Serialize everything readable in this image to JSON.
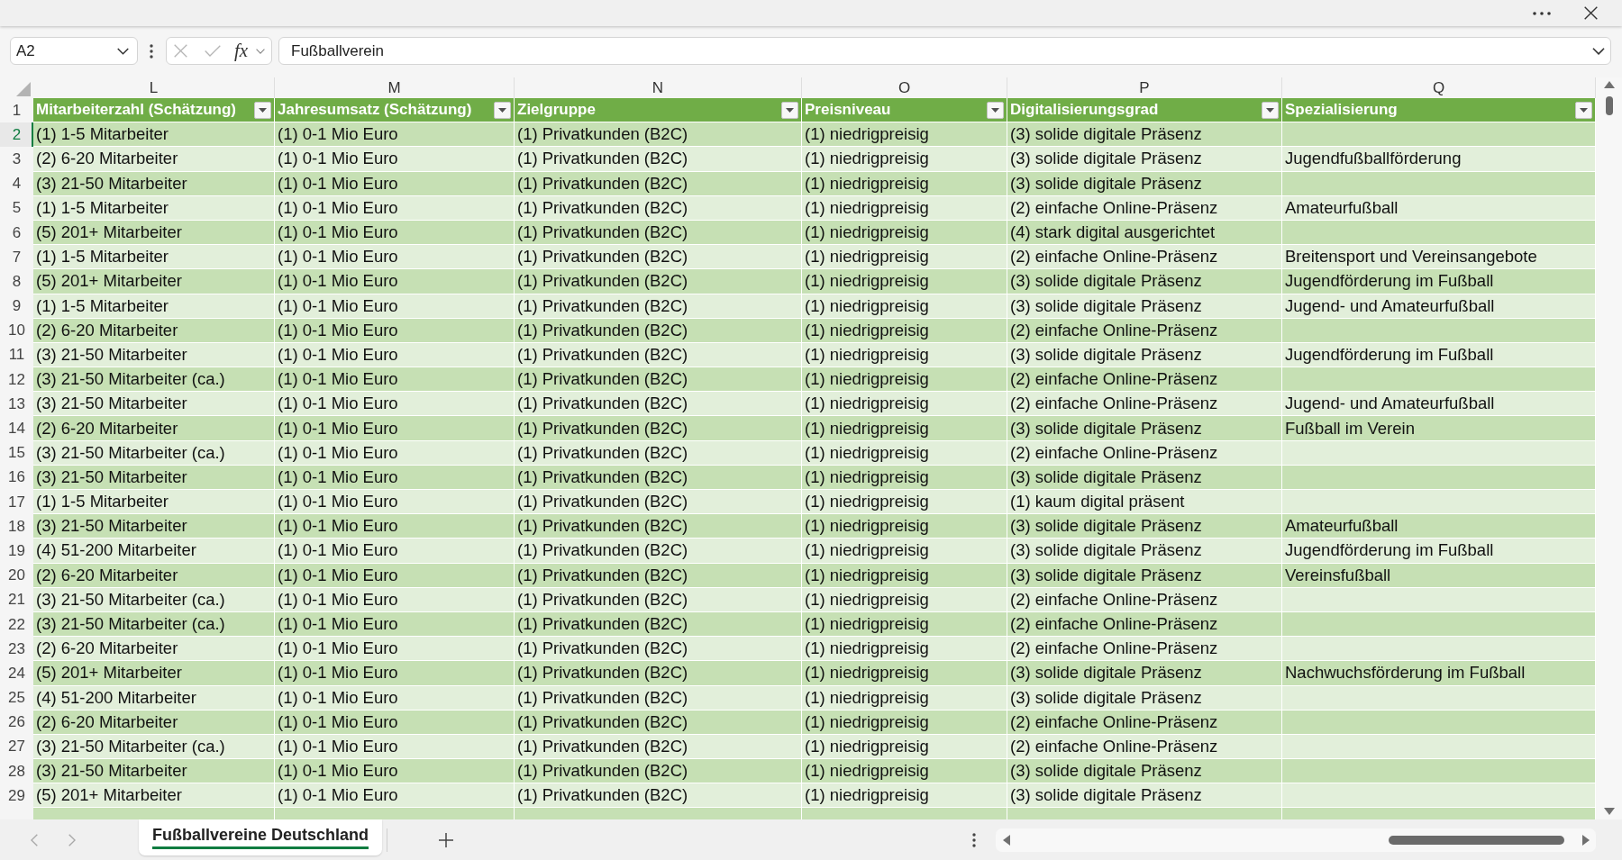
{
  "name_box": {
    "value": "A2"
  },
  "formula_bar": {
    "function_label": "fx",
    "value": "Fußballverein"
  },
  "sheet": {
    "columns": [
      {
        "letter": "L",
        "title": "Mitarbeiterzahl (Schätzung)"
      },
      {
        "letter": "M",
        "title": "Jahresumsatz (Schätzung)"
      },
      {
        "letter": "N",
        "title": "Zielgruppe"
      },
      {
        "letter": "O",
        "title": "Preisniveau"
      },
      {
        "letter": "P",
        "title": "Digitalisierungsgrad"
      },
      {
        "letter": "Q",
        "title": "Spezialisierung"
      }
    ],
    "header_row_number": "1",
    "rows": [
      {
        "number": "2",
        "selected": true,
        "cells": [
          "(1) 1-5 Mitarbeiter",
          "(1) 0-1 Mio Euro",
          "(1) Privatkunden (B2C)",
          "(1) niedrigpreisig",
          "(3) solide digitale Präsenz"
        ]
      },
      {
        "number": "3",
        "selected": false,
        "cells": [
          "(2) 6-20 Mitarbeiter",
          "(1) 0-1 Mio Euro",
          "(1) Privatkunden (B2C)",
          "(1) niedrigpreisig",
          "(3) solide digitale Präsenz",
          "Jugendfußballförderung"
        ]
      },
      {
        "number": "4",
        "selected": false,
        "cells": [
          "(3) 21-50 Mitarbeiter",
          "(1) 0-1 Mio Euro",
          "(1) Privatkunden (B2C)",
          "(1) niedrigpreisig",
          "(3) solide digitale Präsenz"
        ]
      },
      {
        "number": "5",
        "selected": false,
        "cells": [
          "(1) 1-5 Mitarbeiter",
          "(1) 0-1 Mio Euro",
          "(1) Privatkunden (B2C)",
          "(1) niedrigpreisig",
          "(2) einfache Online-Präsenz",
          "Amateurfußball"
        ]
      },
      {
        "number": "6",
        "selected": false,
        "cells": [
          "(5) 201+ Mitarbeiter",
          "(1) 0-1 Mio Euro",
          "(1) Privatkunden (B2C)",
          "(1) niedrigpreisig",
          "(4) stark digital ausgerichtet"
        ]
      },
      {
        "number": "7",
        "selected": false,
        "cells": [
          "(1) 1-5 Mitarbeiter",
          "(1) 0-1 Mio Euro",
          "(1) Privatkunden (B2C)",
          "(1) niedrigpreisig",
          "(2) einfache Online-Präsenz",
          "Breitensport und Vereinsangebote"
        ]
      },
      {
        "number": "8",
        "selected": false,
        "cells": [
          "(5) 201+ Mitarbeiter",
          "(1) 0-1 Mio Euro",
          "(1) Privatkunden (B2C)",
          "(1) niedrigpreisig",
          "(3) solide digitale Präsenz",
          "Jugendförderung im Fußball"
        ]
      },
      {
        "number": "9",
        "selected": false,
        "cells": [
          "(1) 1-5 Mitarbeiter",
          "(1) 0-1 Mio Euro",
          "(1) Privatkunden (B2C)",
          "(1) niedrigpreisig",
          "(3) solide digitale Präsenz",
          "Jugend- und Amateurfußball"
        ]
      },
      {
        "number": "10",
        "selected": false,
        "cells": [
          "(2) 6-20 Mitarbeiter",
          "(1) 0-1 Mio Euro",
          "(1) Privatkunden (B2C)",
          "(1) niedrigpreisig",
          "(2) einfache Online-Präsenz"
        ]
      },
      {
        "number": "11",
        "selected": false,
        "cells": [
          "(3) 21-50 Mitarbeiter",
          "(1) 0-1 Mio Euro",
          "(1) Privatkunden (B2C)",
          "(1) niedrigpreisig",
          "(3) solide digitale Präsenz",
          "Jugendförderung im Fußball"
        ]
      },
      {
        "number": "12",
        "selected": false,
        "cells": [
          "(3) 21-50 Mitarbeiter (ca.)",
          "(1) 0-1 Mio Euro",
          "(1) Privatkunden (B2C)",
          "(1) niedrigpreisig",
          "(2) einfache Online-Präsenz"
        ]
      },
      {
        "number": "13",
        "selected": false,
        "cells": [
          "(3) 21-50 Mitarbeiter",
          "(1) 0-1 Mio Euro",
          "(1) Privatkunden (B2C)",
          "(1) niedrigpreisig",
          "(2) einfache Online-Präsenz",
          "Jugend- und Amateurfußball"
        ]
      },
      {
        "number": "14",
        "selected": false,
        "cells": [
          "(2) 6-20 Mitarbeiter",
          "(1) 0-1 Mio Euro",
          "(1) Privatkunden (B2C)",
          "(1) niedrigpreisig",
          "(3) solide digitale Präsenz",
          "Fußball im Verein"
        ]
      },
      {
        "number": "15",
        "selected": false,
        "cells": [
          "(3) 21-50 Mitarbeiter (ca.)",
          "(1) 0-1 Mio Euro",
          "(1) Privatkunden (B2C)",
          "(1) niedrigpreisig",
          "(2) einfache Online-Präsenz"
        ]
      },
      {
        "number": "16",
        "selected": false,
        "cells": [
          "(3) 21-50 Mitarbeiter",
          "(1) 0-1 Mio Euro",
          "(1) Privatkunden (B2C)",
          "(1) niedrigpreisig",
          "(3) solide digitale Präsenz"
        ]
      },
      {
        "number": "17",
        "selected": false,
        "cells": [
          "(1) 1-5 Mitarbeiter",
          "(1) 0-1 Mio Euro",
          "(1) Privatkunden (B2C)",
          "(1) niedrigpreisig",
          "(1) kaum digital präsent"
        ]
      },
      {
        "number": "18",
        "selected": false,
        "cells": [
          "(3) 21-50 Mitarbeiter",
          "(1) 0-1 Mio Euro",
          "(1) Privatkunden (B2C)",
          "(1) niedrigpreisig",
          "(3) solide digitale Präsenz",
          "Amateurfußball"
        ]
      },
      {
        "number": "19",
        "selected": false,
        "cells": [
          "(4) 51-200 Mitarbeiter",
          "(1) 0-1 Mio Euro",
          "(1) Privatkunden (B2C)",
          "(1) niedrigpreisig",
          "(3) solide digitale Präsenz",
          "Jugendförderung im Fußball"
        ]
      },
      {
        "number": "20",
        "selected": false,
        "cells": [
          "(2) 6-20 Mitarbeiter",
          "(1) 0-1 Mio Euro",
          "(1) Privatkunden (B2C)",
          "(1) niedrigpreisig",
          "(3) solide digitale Präsenz",
          "Vereinsfußball"
        ]
      },
      {
        "number": "21",
        "selected": false,
        "cells": [
          "(3) 21-50 Mitarbeiter (ca.)",
          "(1) 0-1 Mio Euro",
          "(1) Privatkunden (B2C)",
          "(1) niedrigpreisig",
          "(2) einfache Online-Präsenz"
        ]
      },
      {
        "number": "22",
        "selected": false,
        "cells": [
          "(3) 21-50 Mitarbeiter (ca.)",
          "(1) 0-1 Mio Euro",
          "(1) Privatkunden (B2C)",
          "(1) niedrigpreisig",
          "(2) einfache Online-Präsenz"
        ]
      },
      {
        "number": "23",
        "selected": false,
        "cells": [
          "(2) 6-20 Mitarbeiter",
          "(1) 0-1 Mio Euro",
          "(1) Privatkunden (B2C)",
          "(1) niedrigpreisig",
          "(2) einfache Online-Präsenz"
        ]
      },
      {
        "number": "24",
        "selected": false,
        "cells": [
          "(5) 201+ Mitarbeiter",
          "(1) 0-1 Mio Euro",
          "(1) Privatkunden (B2C)",
          "(1) niedrigpreisig",
          "(3) solide digitale Präsenz",
          "Nachwuchsförderung im Fußball"
        ]
      },
      {
        "number": "25",
        "selected": false,
        "cells": [
          "(4) 51-200 Mitarbeiter",
          "(1) 0-1 Mio Euro",
          "(1) Privatkunden (B2C)",
          "(1) niedrigpreisig",
          "(3) solide digitale Präsenz"
        ]
      },
      {
        "number": "26",
        "selected": false,
        "cells": [
          "(2) 6-20 Mitarbeiter",
          "(1) 0-1 Mio Euro",
          "(1) Privatkunden (B2C)",
          "(1) niedrigpreisig",
          "(2) einfache Online-Präsenz"
        ]
      },
      {
        "number": "27",
        "selected": false,
        "cells": [
          "(3) 21-50 Mitarbeiter (ca.)",
          "(1) 0-1 Mio Euro",
          "(1) Privatkunden (B2C)",
          "(1) niedrigpreisig",
          "(2) einfache Online-Präsenz"
        ]
      },
      {
        "number": "28",
        "selected": false,
        "cells": [
          "(3) 21-50 Mitarbeiter",
          "(1) 0-1 Mio Euro",
          "(1) Privatkunden (B2C)",
          "(1) niedrigpreisig",
          "(3) solide digitale Präsenz"
        ]
      },
      {
        "number": "29",
        "selected": false,
        "cells": [
          "(5) 201+ Mitarbeiter",
          "(1) 0-1 Mio Euro",
          "(1) Privatkunden (B2C)",
          "(1) niedrigpreisig",
          "(3) solide digitale Präsenz"
        ]
      }
    ]
  },
  "sheet_tabs": [
    {
      "label": "Fußballvereine Deutschland",
      "selected": true
    }
  ]
}
